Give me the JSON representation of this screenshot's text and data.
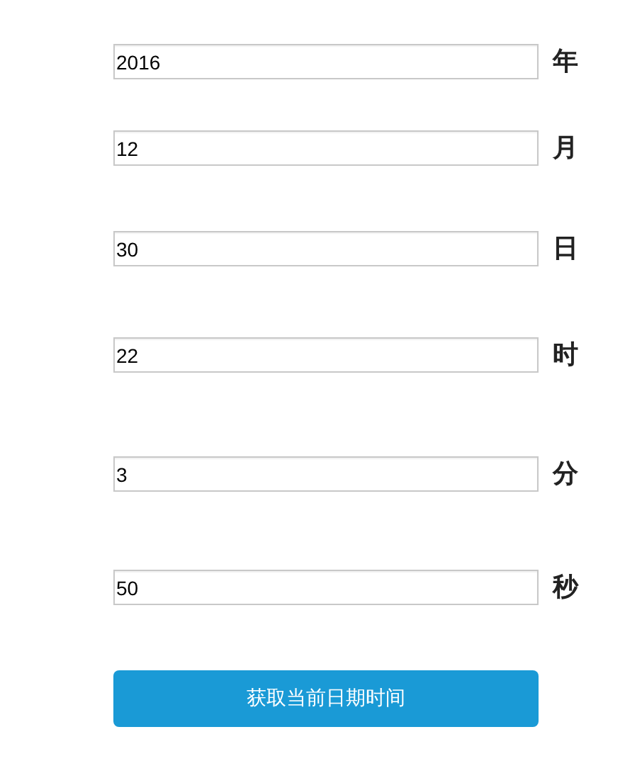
{
  "fields": [
    {
      "value": "2016",
      "unit": "年"
    },
    {
      "value": "12",
      "unit": "月"
    },
    {
      "value": "30",
      "unit": "日"
    },
    {
      "value": "22",
      "unit": "时"
    },
    {
      "value": "3",
      "unit": "分"
    },
    {
      "value": "50",
      "unit": "秒"
    }
  ],
  "button": {
    "label": "获取当前日期时间"
  }
}
